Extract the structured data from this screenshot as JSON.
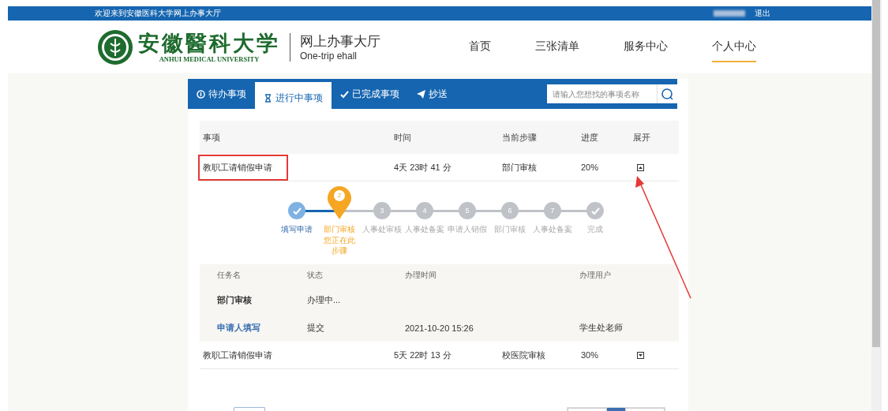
{
  "top_bar": {
    "welcome": "欢迎来到安徽医科大学网上办事大厅",
    "logout": "退出"
  },
  "header": {
    "logo_cn": "安徽醫科大学",
    "logo_en": "ANHUI MEDICAL UNIVERSITY",
    "site_title": "网上办事大厅",
    "site_subtitle": "One-trip ehall",
    "nav": [
      {
        "label": "首页",
        "selected": false
      },
      {
        "label": "三张清单",
        "selected": false
      },
      {
        "label": "服务中心",
        "selected": false
      },
      {
        "label": "个人中心",
        "selected": true
      }
    ]
  },
  "tabs": [
    {
      "label": "待办事项",
      "selected": false
    },
    {
      "label": "进行中事项",
      "selected": true
    },
    {
      "label": "已完成事项",
      "selected": false
    },
    {
      "label": "抄送",
      "selected": false
    }
  ],
  "search": {
    "placeholder": "请输入您想找的事项名称"
  },
  "table": {
    "columns": [
      "事项",
      "时间",
      "当前步骤",
      "进度",
      "展开"
    ],
    "rows": [
      {
        "name": "教职工请销假申请",
        "time": "4天 23时 41 分",
        "step": "部门审核",
        "progress": "20%",
        "expanded": true,
        "highlighted": true,
        "steps": [
          {
            "kind": "check",
            "done": true,
            "current": false,
            "label": "填写申请"
          },
          {
            "kind": "number",
            "number": "2",
            "done": false,
            "current": true,
            "label": "部门审核",
            "note": "您正在此步骤"
          },
          {
            "kind": "number",
            "number": "3",
            "done": false,
            "current": false,
            "label": "人事处审核"
          },
          {
            "kind": "number",
            "number": "4",
            "done": false,
            "current": false,
            "label": "人事处备案"
          },
          {
            "kind": "number",
            "number": "5",
            "done": false,
            "current": false,
            "label": "申请人销假"
          },
          {
            "kind": "number",
            "number": "6",
            "done": false,
            "current": false,
            "label": "部门审核"
          },
          {
            "kind": "number",
            "number": "7",
            "done": false,
            "current": false,
            "label": "人事处备案"
          },
          {
            "kind": "check",
            "done": false,
            "current": false,
            "label": "完成"
          }
        ],
        "detail": {
          "columns": [
            "任务名",
            "状态",
            "办理时间",
            "办理用户"
          ],
          "rows": [
            {
              "kind": "active",
              "task": "部门审核",
              "status": "办理中..."
            },
            {
              "kind": "link",
              "task": "申请人填写",
              "status": "提交",
              "time": "2021-10-20 15:26",
              "user": "学生处老师"
            }
          ]
        }
      },
      {
        "name": "教职工请销假申请",
        "time": "5天 22时 13 分",
        "step": "校医院审核",
        "progress": "30%",
        "expanded": false,
        "highlighted": false
      }
    ]
  },
  "pager": {
    "pages": [
      {
        "selected": false
      },
      {
        "selected": true
      },
      {
        "selected": false
      }
    ]
  },
  "annotations": [
    {
      "kind": "arrow"
    }
  ]
}
